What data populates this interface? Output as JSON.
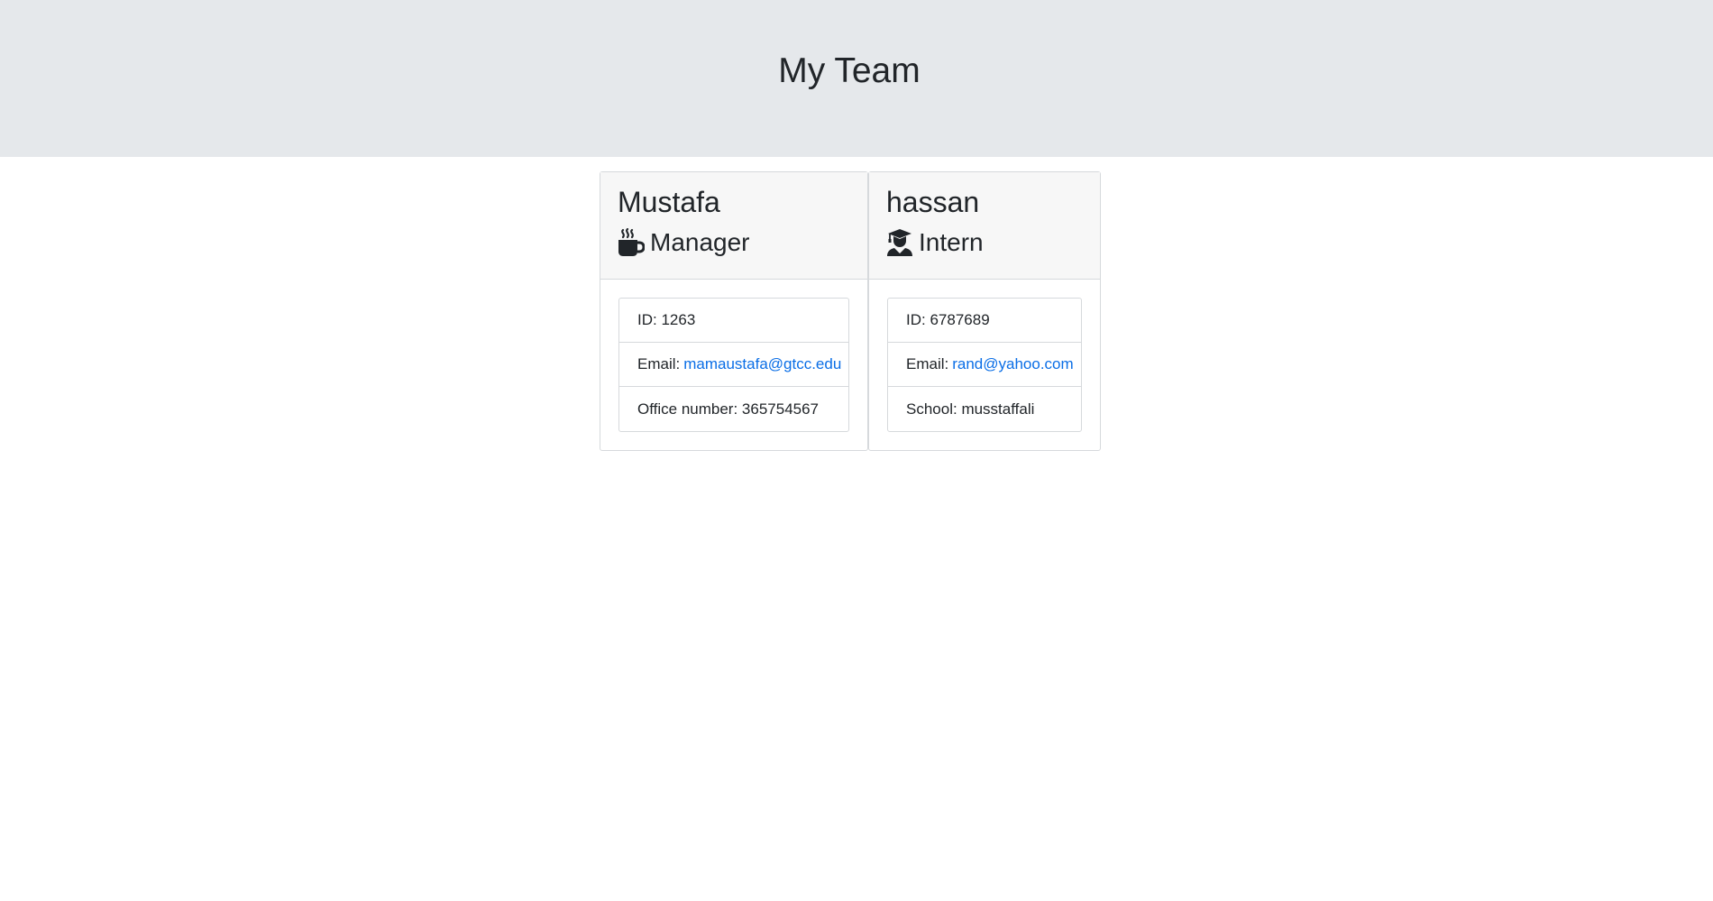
{
  "header": {
    "title": "My Team"
  },
  "employees": [
    {
      "name": "Mustafa",
      "role": "Manager",
      "role_icon": "mug-icon",
      "id_label": "ID:",
      "id": "1263",
      "email_label": "Email:",
      "email": "mamaustafa@gtcc.edu",
      "extra_label": "Office number:",
      "extra": "365754567"
    },
    {
      "name": "hassan",
      "role": "Intern",
      "role_icon": "graduate-icon",
      "id_label": "ID:",
      "id": "6787689",
      "email_label": "Email:",
      "email": "rand@yahoo.com",
      "extra_label": "School:",
      "extra": "musstaffali"
    }
  ],
  "colors": {
    "header_bg": "#e5e8eb",
    "card_header_bg": "#f7f7f7",
    "link": "#0a6ee6",
    "text": "#212529"
  }
}
